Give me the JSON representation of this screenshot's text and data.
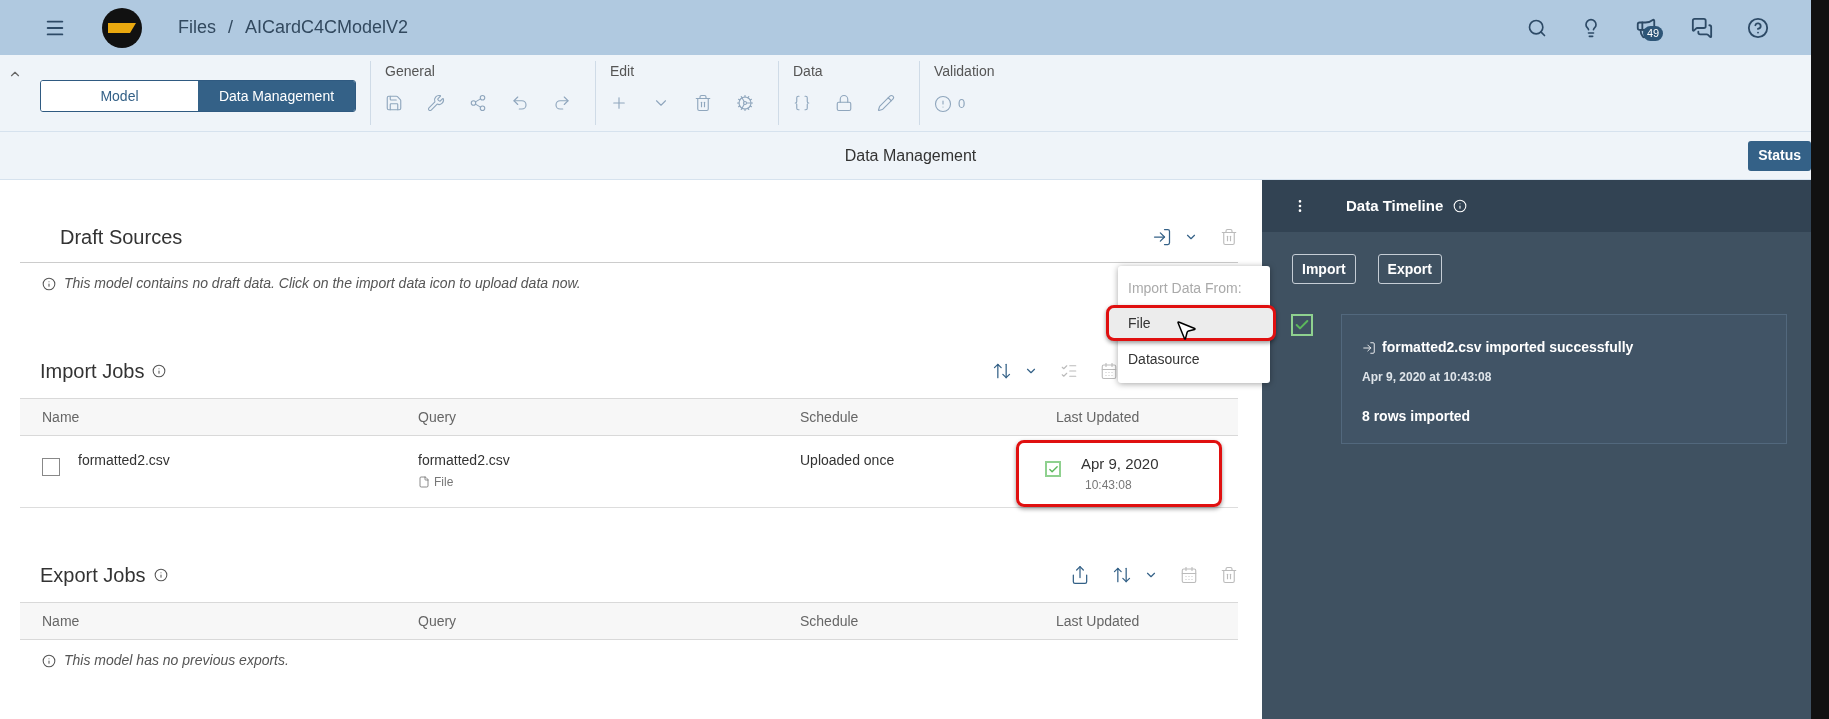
{
  "header": {
    "breadcrumb": [
      {
        "label": "Files"
      },
      {
        "label": "AICardC4CModelV2"
      }
    ],
    "separator": "/",
    "notifications_badge": "49"
  },
  "toolbar": {
    "tabs": [
      {
        "label": "Model",
        "selected": false
      },
      {
        "label": "Data Management",
        "selected": true
      }
    ],
    "groups": [
      {
        "title": "General"
      },
      {
        "title": "Edit"
      },
      {
        "title": "Data"
      },
      {
        "title": "Validation",
        "count": "0"
      }
    ]
  },
  "page_title": "Data Management",
  "status_button": "Status",
  "draft_sources": {
    "title": "Draft Sources",
    "message": "This model contains no draft data. Click on the import data icon to upload data now."
  },
  "import_menu": {
    "heading": "Import Data From:",
    "items": [
      {
        "label": "File",
        "selected": true
      },
      {
        "label": "Datasource",
        "selected": false
      }
    ]
  },
  "import_jobs": {
    "title": "Import Jobs",
    "columns": [
      "Name",
      "Query",
      "Schedule",
      "Last Updated"
    ],
    "rows": [
      {
        "checked": false,
        "name": "formatted2.csv",
        "query": "formatted2.csv",
        "query_type": "File",
        "schedule": "Uploaded once",
        "success": true,
        "highlighted": true,
        "date": "Apr 9, 2020",
        "time": "10:43:08"
      }
    ]
  },
  "export_jobs": {
    "title": "Export Jobs",
    "columns": [
      "Name",
      "Query",
      "Schedule",
      "Last Updated"
    ],
    "message": "This model has no previous exports."
  },
  "timeline": {
    "title": "Data Timeline",
    "buttons": [
      "Import",
      "Export"
    ],
    "entries": [
      {
        "success": true,
        "title": "formatted2.csv imported successfully",
        "timestamp": "Apr 9, 2020 at 10:43:08",
        "detail": "8 rows imported"
      }
    ]
  }
}
